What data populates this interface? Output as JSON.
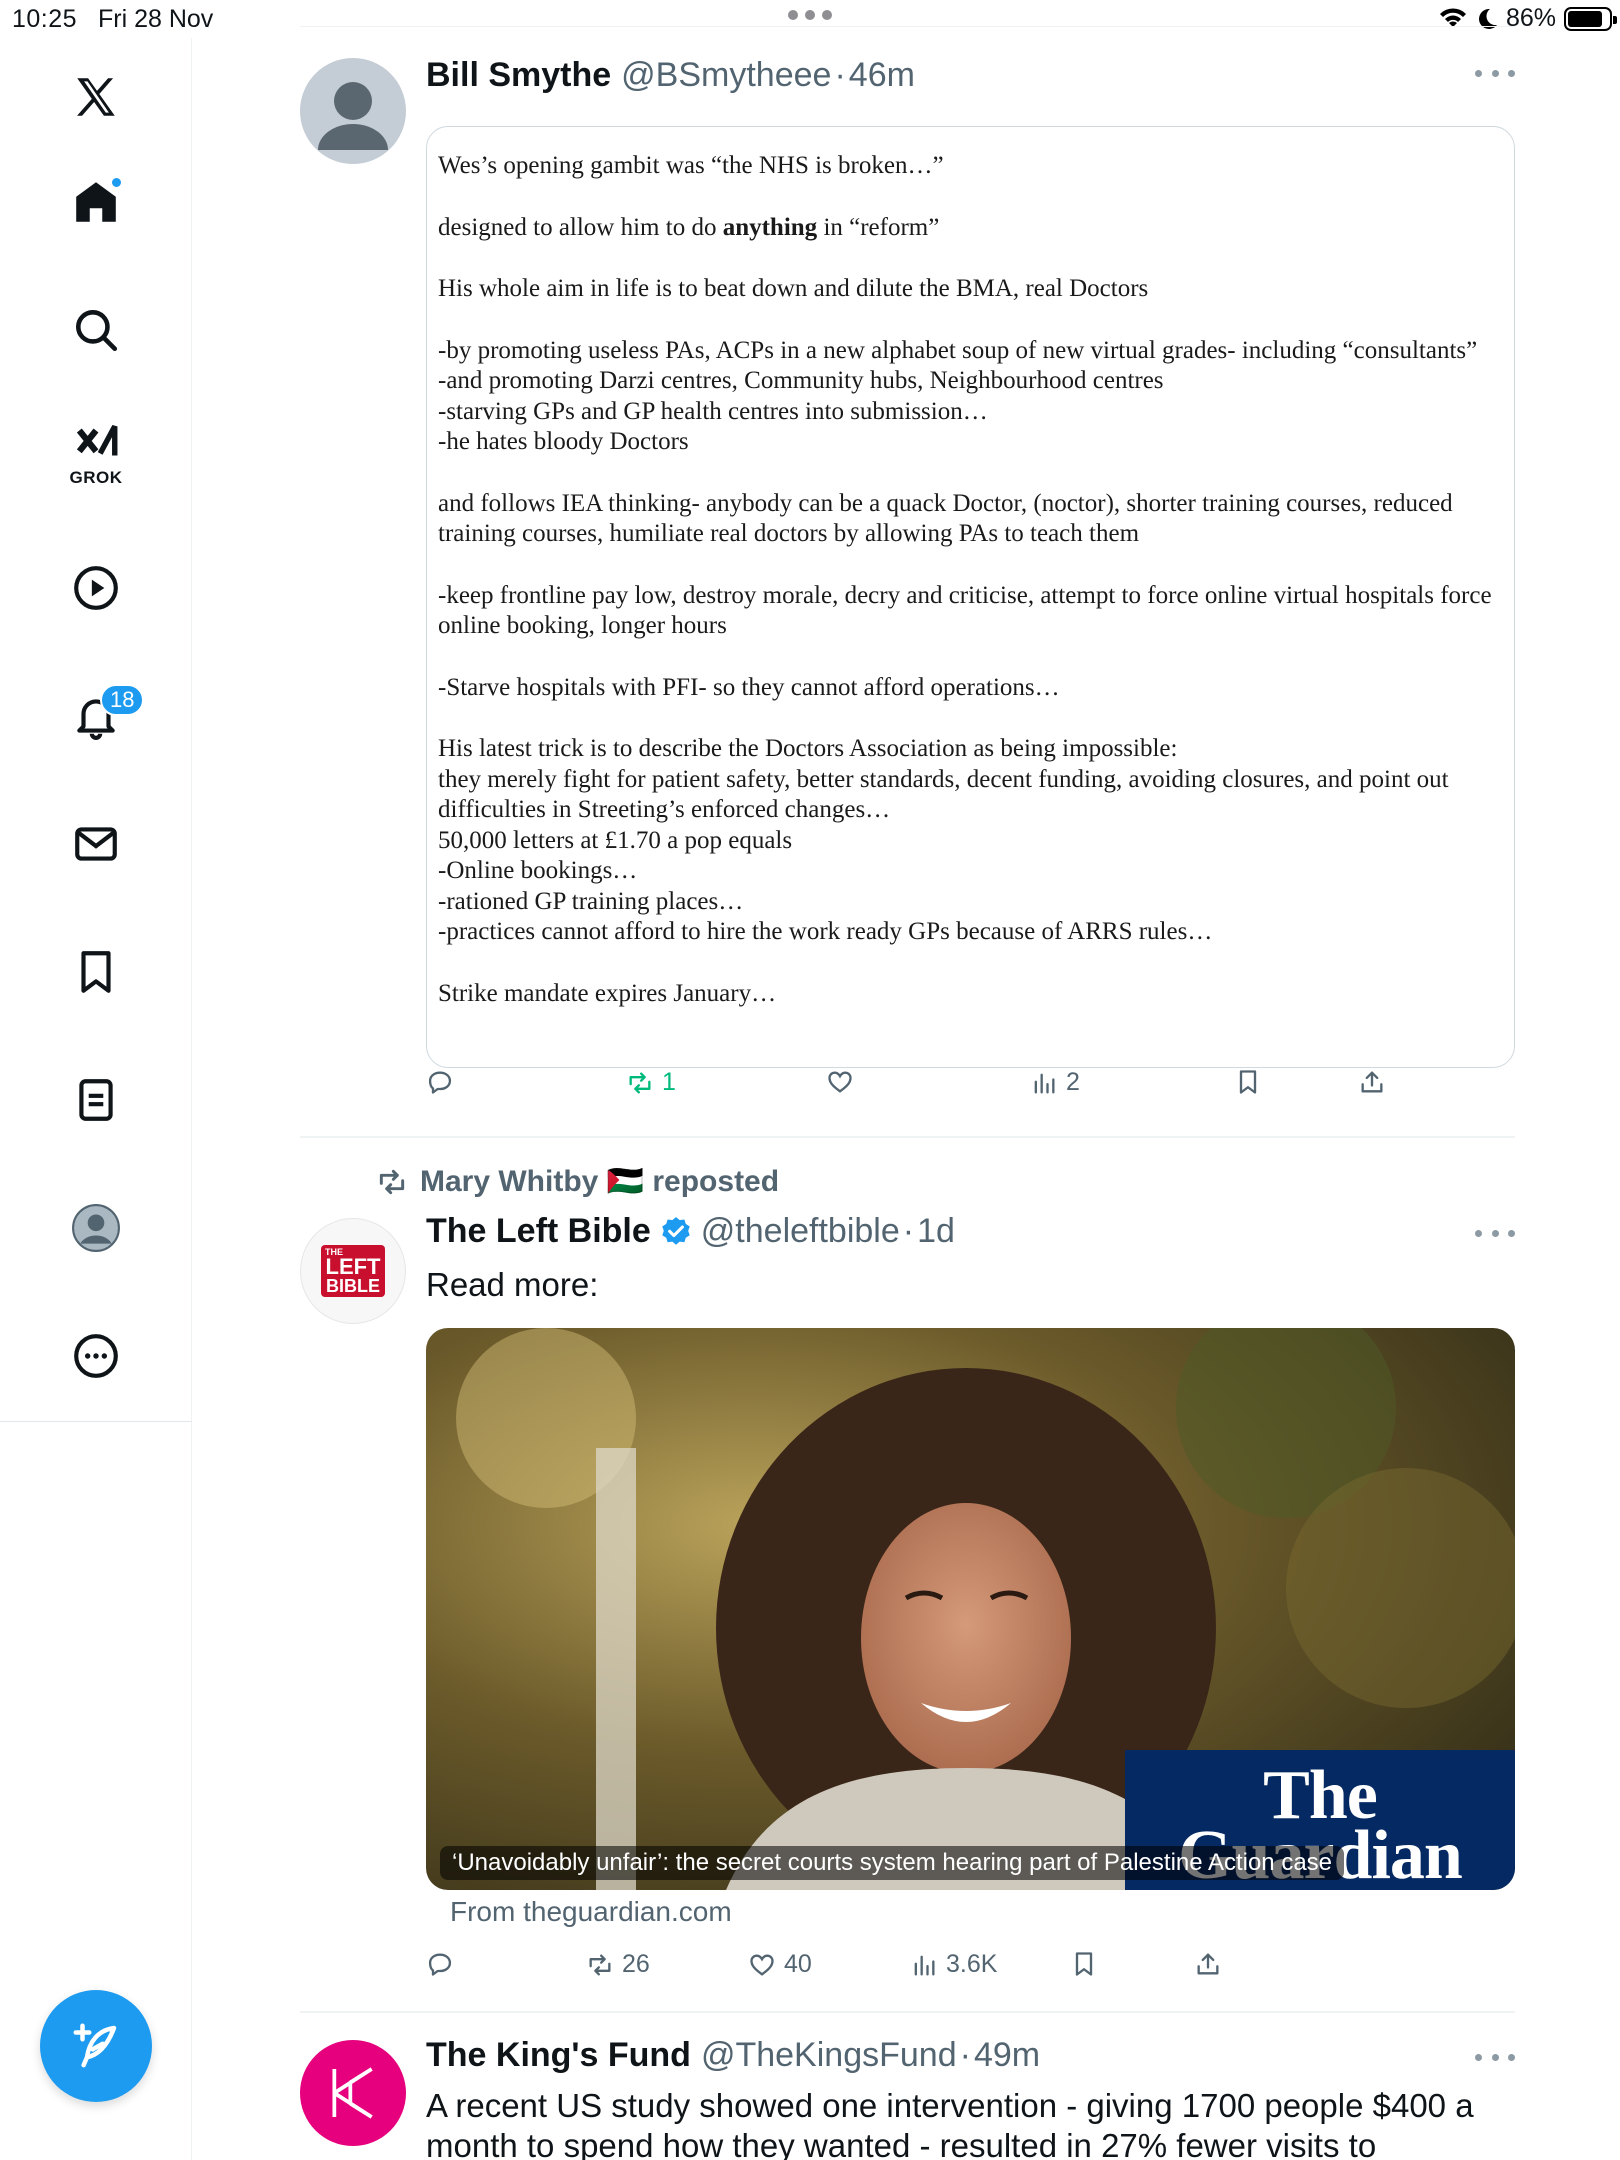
{
  "status_bar": {
    "time": "10:25",
    "date": "Fri 28 Nov",
    "battery": "86%",
    "battery_level": 0.86
  },
  "sidebar": {
    "notifications_badge": "18",
    "grok_label": "GROK"
  },
  "posts": [
    {
      "name": "Bill Smythe",
      "handle": "@BSmytheee",
      "separator": "·",
      "time": "46m",
      "text_paragraphs": [
        "Wes’s opening gambit was “the NHS is broken…”",
        "designed to allow him to do |anything| in “reform”",
        "His whole aim in life is to beat down and dilute the BMA, real Doctors",
        "-by promoting useless PAs, ACPs in a new alphabet soup of new virtual grades- including “consultants”\n-and promoting Darzi centres, Community hubs, Neighbourhood centres\n-starving GPs and GP health centres into submission…\n-he hates bloody Doctors",
        "and follows IEA thinking- anybody can be a quack Doctor, (noctor), shorter training courses, reduced training courses, humiliate real doctors by allowing PAs to teach them",
        "-keep frontline pay low, destroy morale, decry and criticise, attempt to force online virtual hospitals force online booking, longer hours",
        "-Starve hospitals with PFI- so they cannot afford operations…",
        "His latest trick is to describe the Doctors Association as being impossible:\nthey merely fight for patient safety, better standards, decent funding, avoiding closures, and point out difficulties in Streeting’s enforced changes…\n50,000 letters at £1.70 a pop equals\n-Online bookings…\n-rationed GP training places…\n-practices cannot afford to hire the work ready GPs because of ARRS rules…",
        "Strike mandate expires January…"
      ],
      "actions": {
        "replies": "",
        "reposts": "1",
        "likes": "",
        "views": "2"
      }
    },
    {
      "reposted_by": "Mary Whitby 🇵🇸 reposted",
      "name": "The Left Bible",
      "handle": "@theleftbible",
      "separator": "·",
      "time": "1d",
      "avatar_text": "THE LEFT BIBLE",
      "text": "Read more:",
      "media_caption": "‘Unavoidably unfair’: the secret courts system hearing part of Palestine Action case",
      "media_brand": "The Guardian",
      "link_source": "From theguardian.com",
      "actions": {
        "replies": "",
        "reposts": "26",
        "likes": "40",
        "views": "3.6K"
      }
    },
    {
      "name": "The King's Fund",
      "handle": "@TheKingsFund",
      "separator": "·",
      "time": "49m",
      "text": "A recent US study showed one intervention - giving 1700 people $400 a month to spend how they wanted - resulted in 27% fewer visits to"
    }
  ],
  "colors": {
    "accent": "#1d9bf0",
    "retweet_active": "#00ba7c",
    "secondary_text": "#536471",
    "guardian_blue": "#052962",
    "kings_fund_magenta": "#e6007e"
  }
}
